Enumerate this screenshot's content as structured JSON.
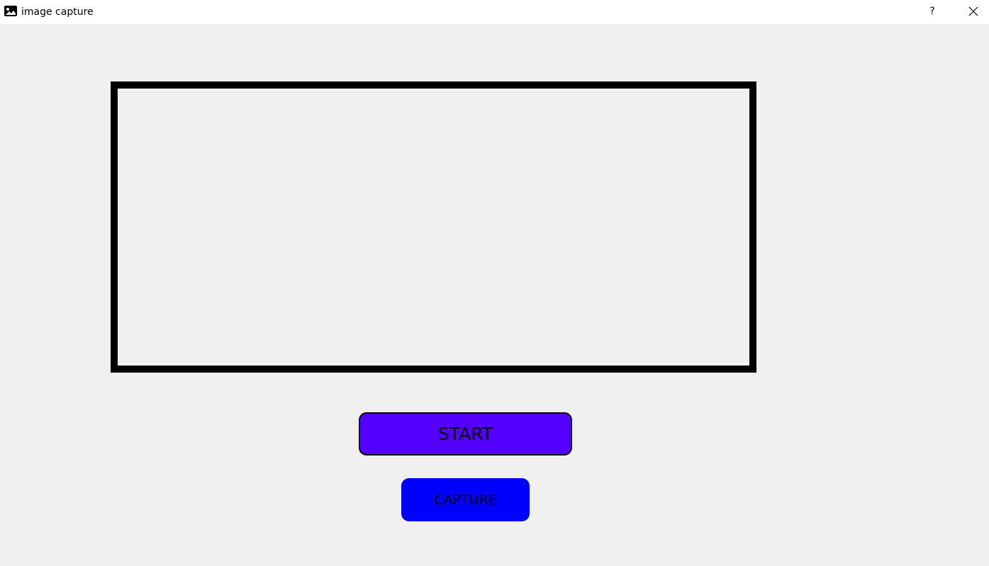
{
  "window": {
    "title": "image capture",
    "help_label": "?"
  },
  "icons": {
    "app": "image-icon",
    "close": "close-icon"
  },
  "preview": {
    "border_color": "#000000"
  },
  "buttons": {
    "start_label": "START",
    "start_color": "#5500ff",
    "capture_label": "CAPTURE",
    "capture_color": "#0000ff"
  }
}
